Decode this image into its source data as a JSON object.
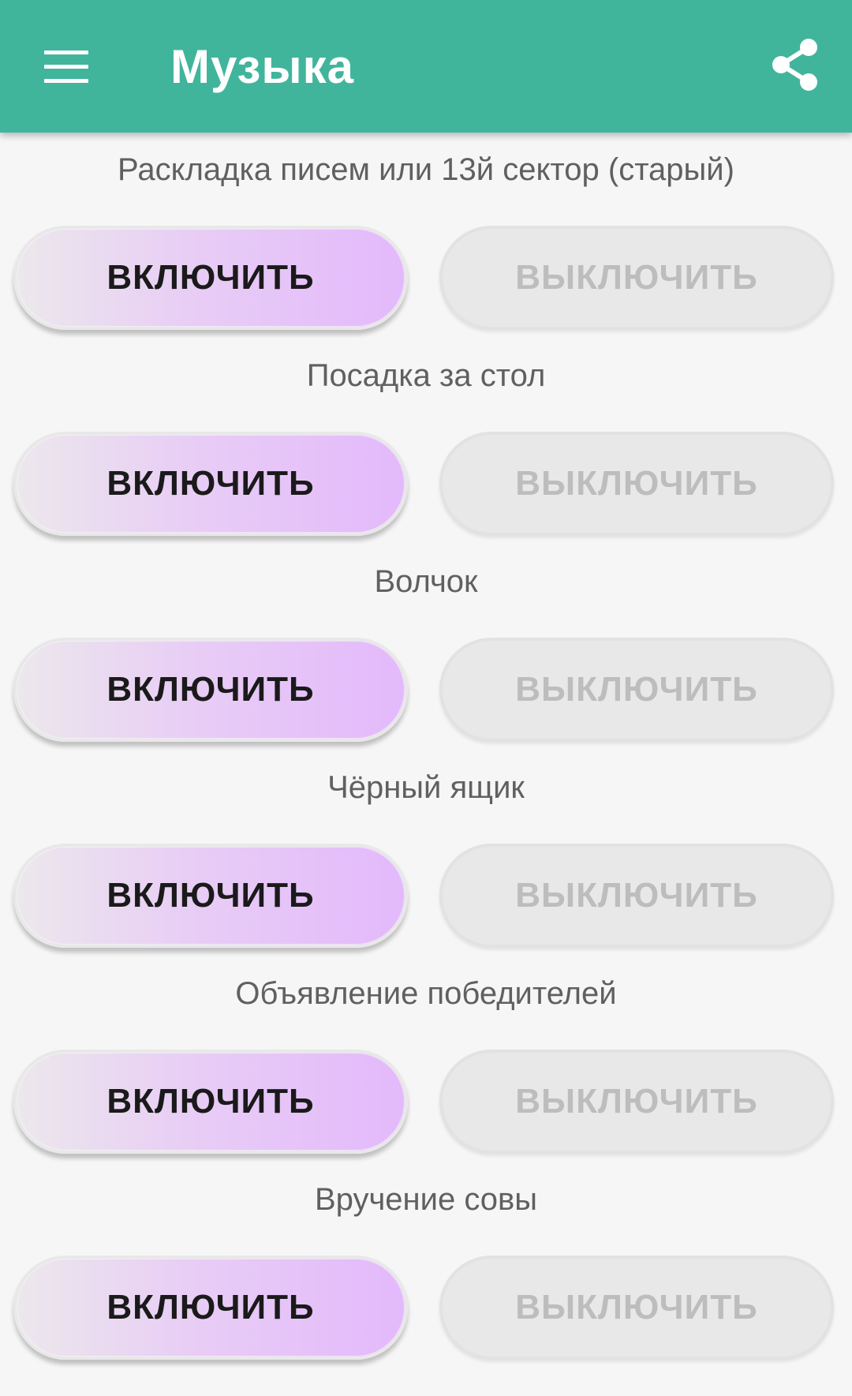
{
  "appbar": {
    "title": "Музыка",
    "menu_icon": "menu-icon",
    "share_icon": "share-icon",
    "color": "#41b59c"
  },
  "sections": [
    {
      "label": "Раскладка писем или 13й сектор (старый)",
      "on_label": "ВКЛЮЧИТЬ",
      "off_label": "ВЫКЛЮЧИТЬ"
    },
    {
      "label": "Посадка за стол",
      "on_label": "ВКЛЮЧИТЬ",
      "off_label": "ВЫКЛЮЧИТЬ"
    },
    {
      "label": "Волчок",
      "on_label": "ВКЛЮЧИТЬ",
      "off_label": "ВЫКЛЮЧИТЬ"
    },
    {
      "label": "Чёрный ящик",
      "on_label": "ВКЛЮЧИТЬ",
      "off_label": "ВЫКЛЮЧИТЬ"
    },
    {
      "label": "Объявление победителей",
      "on_label": "ВКЛЮЧИТЬ",
      "off_label": "ВЫКЛЮЧИТЬ"
    },
    {
      "label": "Вручение совы",
      "on_label": "ВКЛЮЧИТЬ",
      "off_label": "ВЫКЛЮЧИТЬ"
    }
  ],
  "colors": {
    "on_button_gradient_end": "#e3b9fb",
    "off_button_bg": "#e8e8e8",
    "off_button_text": "#bdbdbd"
  }
}
